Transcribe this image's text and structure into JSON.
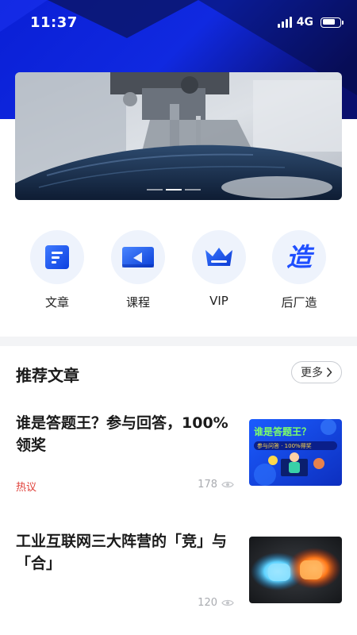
{
  "status_bar": {
    "time": "11:37",
    "network": "4G"
  },
  "banner": {
    "slide_count": 3,
    "active_slide": 1
  },
  "shortcuts": [
    {
      "label": "文章",
      "icon": "article-icon"
    },
    {
      "label": "课程",
      "icon": "course-icon"
    },
    {
      "label": "VIP",
      "icon": "crown-icon"
    },
    {
      "label": "后厂造",
      "icon": "zao-icon",
      "glyph": "造"
    }
  ],
  "section": {
    "title": "推荐文章",
    "more_label": "更多"
  },
  "articles": [
    {
      "title": "谁是答题王？参与回答，100%领奖",
      "tag": "热议",
      "views": "178",
      "thumb_title": "谁是答题王？",
      "thumb_subtitle": "参与问答 · 100%得奖"
    },
    {
      "title": "工业互联网三大阵营的「竞」与「合」",
      "tag": "",
      "views": "120"
    }
  ],
  "colors": {
    "brand_blue": "#1f4fff",
    "tag_red": "#e0413a"
  }
}
